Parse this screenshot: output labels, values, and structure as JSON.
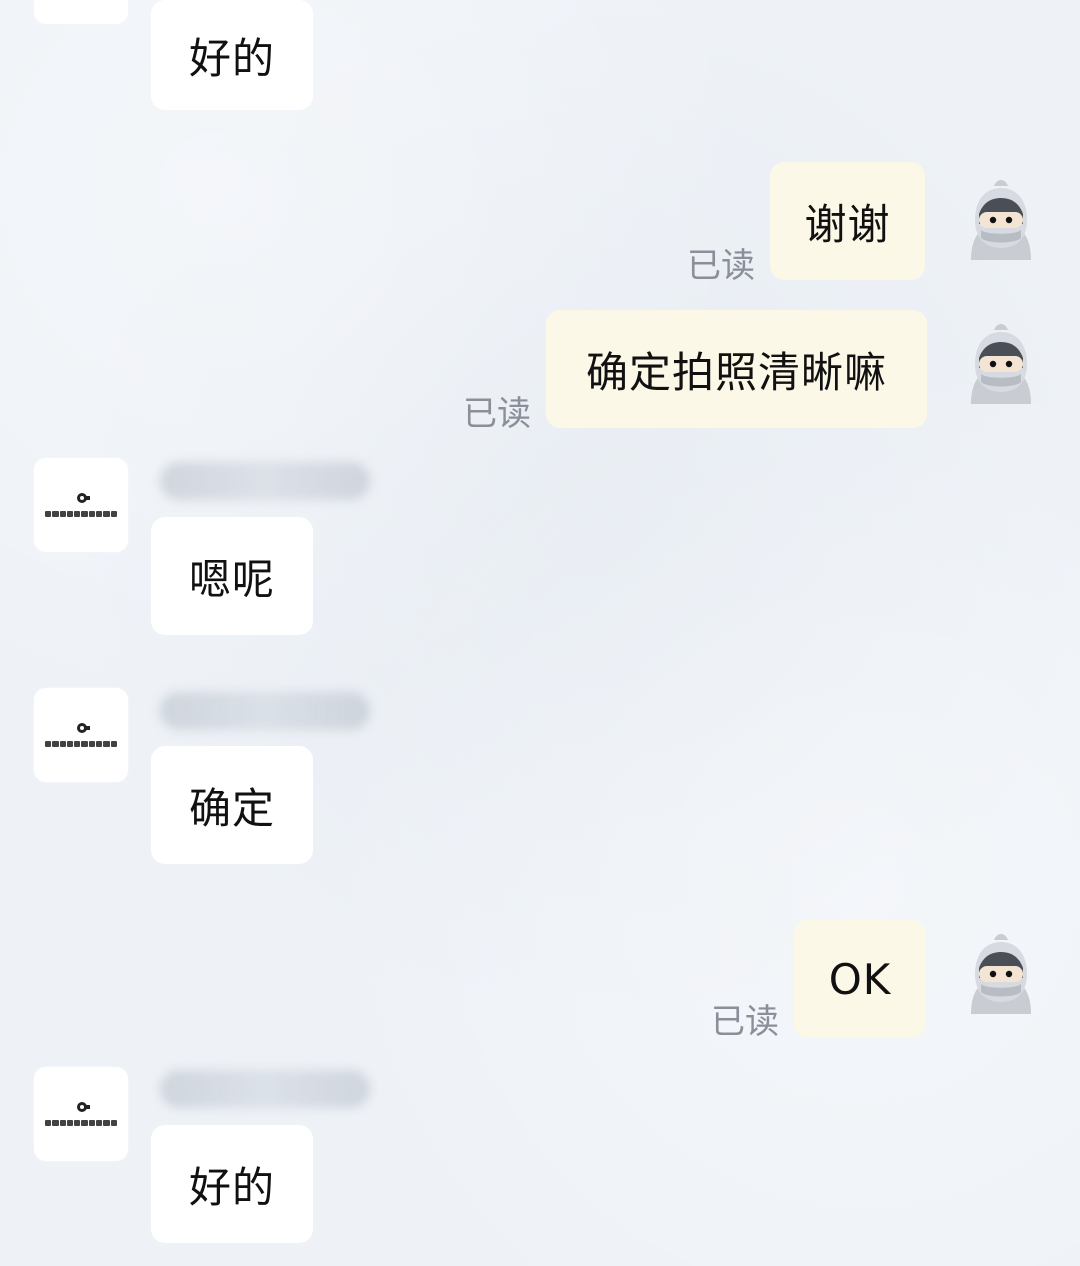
{
  "messages": {
    "m1": {
      "text": "好的"
    },
    "m2": {
      "text": "谢谢",
      "status": "已读"
    },
    "m3": {
      "text": "确定拍照清晰嘛",
      "status": "已读"
    },
    "m4": {
      "text": "嗯呢"
    },
    "m5": {
      "text": "确定"
    },
    "m6": {
      "text": "OK",
      "status": "已读"
    },
    "m7": {
      "text": "好的"
    }
  },
  "icons": {
    "left_avatar": "company-logo-avatar",
    "right_avatar": "knight-avatar"
  },
  "colors": {
    "background": "#eef2f7",
    "incoming_bubble": "#ffffff",
    "outgoing_bubble": "#fcf8e8",
    "read_receipt": "#8a8f99"
  }
}
